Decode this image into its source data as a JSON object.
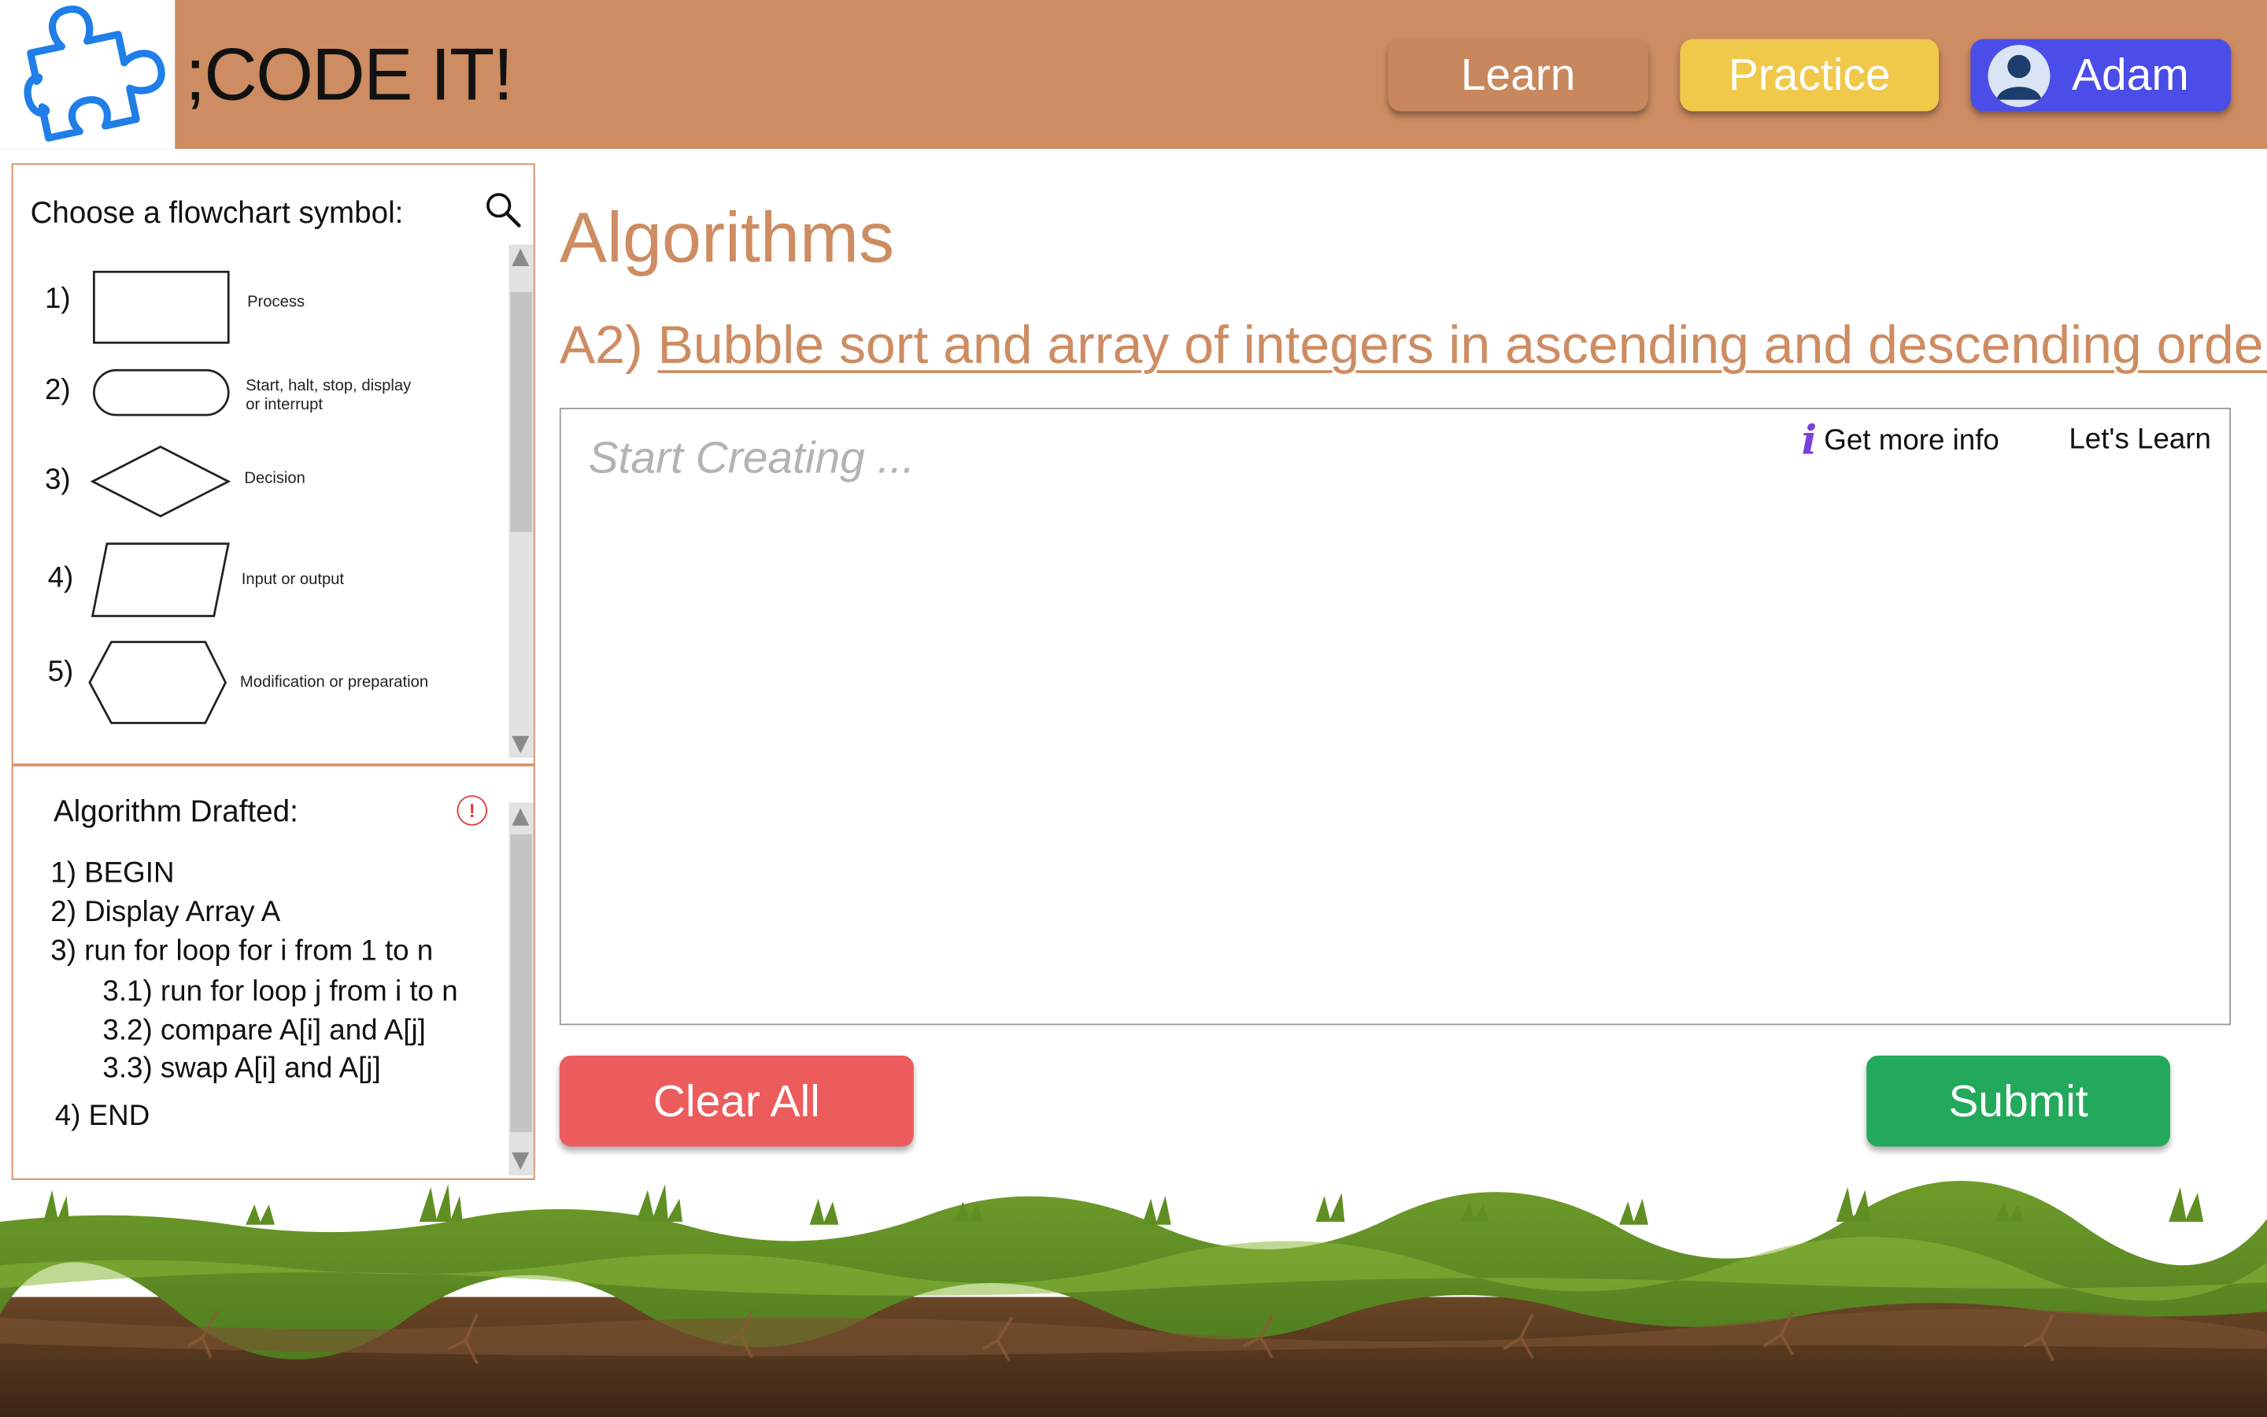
{
  "header": {
    "brand": ";CODE IT!",
    "nav": {
      "learn": "Learn",
      "practice": "Practice"
    },
    "user": {
      "name": "Adam"
    }
  },
  "symbols_panel": {
    "title": "Choose a flowchart symbol:",
    "items": [
      {
        "num": "1)",
        "label_lines": [
          "Process"
        ]
      },
      {
        "num": "2)",
        "label_lines": [
          "Start, halt, stop, display",
          "or interrupt"
        ]
      },
      {
        "num": "3)",
        "label_lines": [
          "Decision"
        ]
      },
      {
        "num": "4)",
        "label_lines": [
          "Input or output"
        ]
      },
      {
        "num": "5)",
        "label_lines": [
          "Modification or preparation"
        ]
      }
    ]
  },
  "draft_panel": {
    "title": "Algorithm Drafted:",
    "steps": [
      "1) BEGIN",
      "2) Display Array A",
      "3) run for loop for i from 1 to n",
      "3.1) run for loop j from i to n",
      "3.2) compare A[i] and A[j]",
      "3.3) swap A[i] and A[j]",
      "4) END"
    ]
  },
  "main": {
    "title": "Algorithms",
    "subtitle_prefix": "A2)",
    "subtitle_link": "Bubble sort and array of integers in ascending and descending order",
    "editor_placeholder": "Start Creating ...",
    "info_label": "Get more info",
    "lets_learn": "Let's Learn",
    "clear_label": "Clear All",
    "submit_label": "Submit"
  },
  "colors": {
    "header_bg": "#cd8c62",
    "practice_btn": "#f0c84a",
    "user_btn": "#4b4de8",
    "clear_btn": "#ec5c5c",
    "submit_btn": "#23a95c",
    "accent_text": "#cd8c62"
  },
  "icons": [
    "puzzle-logo-icon",
    "search-icon",
    "user-avatar-icon",
    "warning-icon",
    "info-icon"
  ]
}
